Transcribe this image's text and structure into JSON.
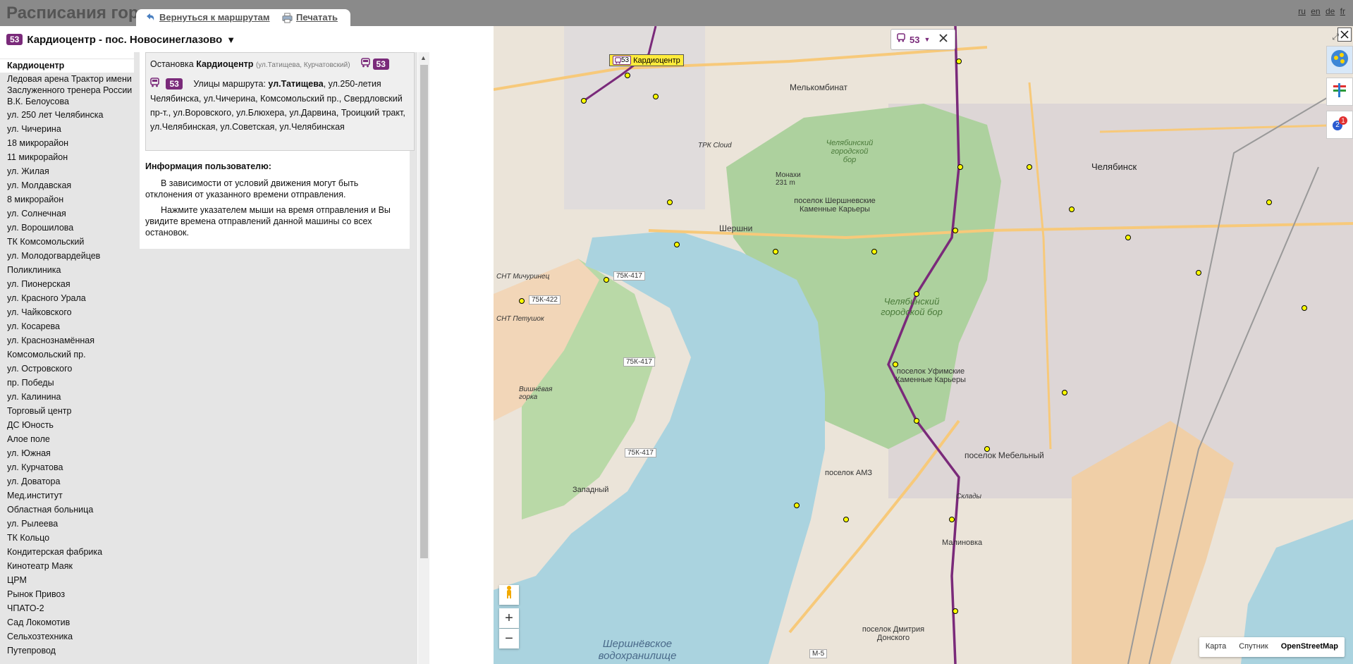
{
  "header": {
    "title": "Расписания гор",
    "back_link": "Вернуться к маршрутам",
    "print_link": "Печатать",
    "languages": [
      "ru",
      "en",
      "de",
      "fr"
    ]
  },
  "route": {
    "number": "53",
    "name": "Кардиоцентр - пос. Новосинеглазово",
    "dropdown_glyph": "▼"
  },
  "stops": [
    "Кардиоцентр",
    "Ледовая арена Трактор имени Заслуженного тренера России В.К. Белоусова",
    "ул. 250 лет Челябинска",
    "ул. Чичерина",
    "18 микрорайон",
    "11 микрорайон",
    "ул. Жилая",
    "ул. Молдавская",
    "8 микрорайон",
    "ул. Солнечная",
    "ул. Ворошилова",
    "ТК Комсомольский",
    "ул. Молодогвардейцев",
    "Поликлиника",
    "ул. Пионерская",
    "ул. Красного Урала",
    "ул. Чайковского",
    "ул. Косарева",
    "ул. Краснознамённая",
    "Комсомольский пр.",
    "ул. Островского",
    "пр. Победы",
    "ул. Калинина",
    "Торговый центр",
    "ДС Юность",
    "Алое поле",
    "ул. Южная",
    "ул. Курчатова",
    "ул. Доватора",
    "Мед.институт",
    "Областная больница",
    "ул. Рылеева",
    "ТК Кольцо",
    "Кондитерская фабрика",
    "Кинотеатр Маяк",
    "ЦРМ",
    "Рынок Привоз",
    "ЧПАТО-2",
    "Сад Локомотив",
    "Сельхозтехника",
    "Путепровод"
  ],
  "stop_info": {
    "prefix": "Остановка",
    "stop_name": "Кардиоцентр",
    "cross_streets": "(ул.Татищева, Курчатовский)",
    "route_badge": "53",
    "streets_label": "Улицы маршрута:",
    "streets_first": "ул.Татищева",
    "streets_rest": ", ул.250-летия Челябинска, ул.Чичерина, Комсомольский пр., Свердловский пр-т., ул.Воровского, ул.Блюхера, ул.Дарвина, Троицкий тракт, ул.Челябинская, ул.Советская, ул.Челябинская"
  },
  "user_info": {
    "heading": "Информация пользователю:",
    "para1": "В зависимости от условий движения могут быть отклонения от указанного времени отправления.",
    "para2": "Нажмите указателем мыши на время отправления и Вы увидите времена отправлений данной машины со всех остановок."
  },
  "map": {
    "route_filter": "53",
    "stop_marker_number": "53",
    "stop_marker_label": "Кардиоцентр",
    "labels": {
      "melkombinat": "Мелькомбинат",
      "chelyabinsk": "Челябинск",
      "bor1": "Челябинский городской бор",
      "bor2": "Челябинский городской бор",
      "shershni": "Шершни",
      "sherh_karery": "поселок Шершневские Каменные Карьеры",
      "ufim_karery": "поселок Уфимские Каменные Карьеры",
      "mebelny": "поселок Мебельный",
      "amz": "поселок АМЗ",
      "malinovka": "Малиновка",
      "zapadny": "Западный",
      "dimitriya": "поселок Дмитрия Донского",
      "reservoir": "Шершнёвское водохранилище",
      "road1": "75К-417",
      "road2": "75К-422",
      "road3": "75К-417",
      "road4": "75К-417",
      "snt1": "СНТ Мичуринец",
      "snt2": "СНТ Петушок",
      "trk": "ТРК Cloud",
      "monakhi": "Монахи 231 m",
      "vishnevaya": "Вишнёвая горка",
      "skladi": "Склады",
      "m5": "М-5"
    },
    "map_types": [
      "Карта",
      "Спутник",
      "OpenStreetMap"
    ],
    "zoom_in": "+",
    "zoom_out": "−",
    "notification_count": "1",
    "notification_small": "2"
  },
  "colors": {
    "route_purple": "#7a2a7a",
    "water": "#aad3df",
    "forest": "#add19e",
    "stop_yellow": "#ffff00",
    "header_gray": "#8a8a8a"
  }
}
